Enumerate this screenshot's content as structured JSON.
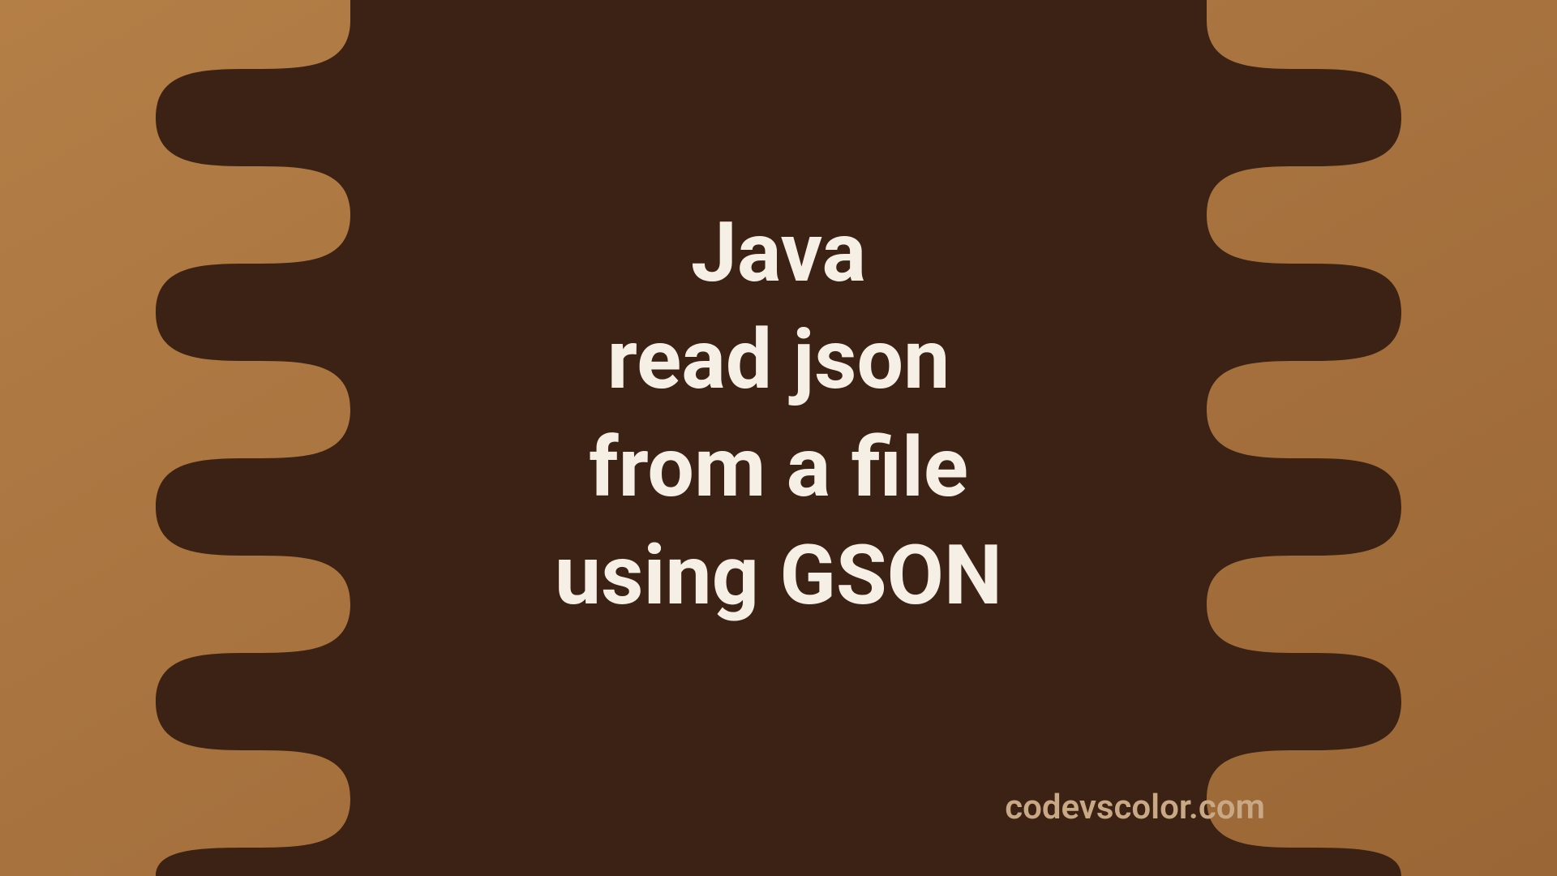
{
  "title": {
    "lines": [
      "Java",
      "read json",
      "from a file",
      "using GSON"
    ]
  },
  "credit": "codevscolor.com",
  "colors": {
    "bg_light": "#A6713E",
    "bg_dark": "#3B2214",
    "text_title": "#F5EFE6",
    "text_credit": "#C9A885"
  }
}
